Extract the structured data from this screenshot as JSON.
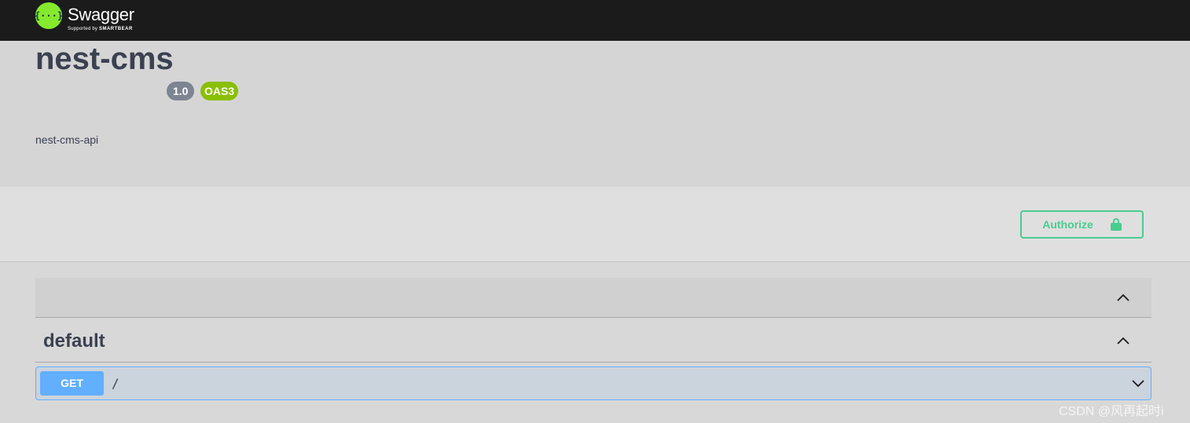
{
  "topbar": {
    "logo_icon": "{···}",
    "logo_name": "Swagger",
    "logo_sub_prefix": "Supported by",
    "logo_sub_brand": "SMARTBEAR"
  },
  "info": {
    "title": "nest-cms",
    "version": "1.0",
    "oas": "OAS3",
    "description": "nest-cms-api"
  },
  "scheme": {
    "authorize_label": "Authorize",
    "authorize_icon": "lock-icon"
  },
  "sections": {
    "empty_section_icon": "chevron-up-icon",
    "tag": {
      "name": "default",
      "icon": "chevron-up-icon"
    }
  },
  "operations": [
    {
      "method": "GET",
      "path": "/",
      "icon": "chevron-down-icon"
    }
  ],
  "watermark": "CSDN @风再起时i",
  "colors": {
    "topbar_bg": "#1b1b1b",
    "logo_green": "#85ea2d",
    "authorize_green": "#49cc90",
    "get_blue": "#61affe",
    "oas_badge": "#89bf04",
    "version_badge": "#7d8492"
  }
}
